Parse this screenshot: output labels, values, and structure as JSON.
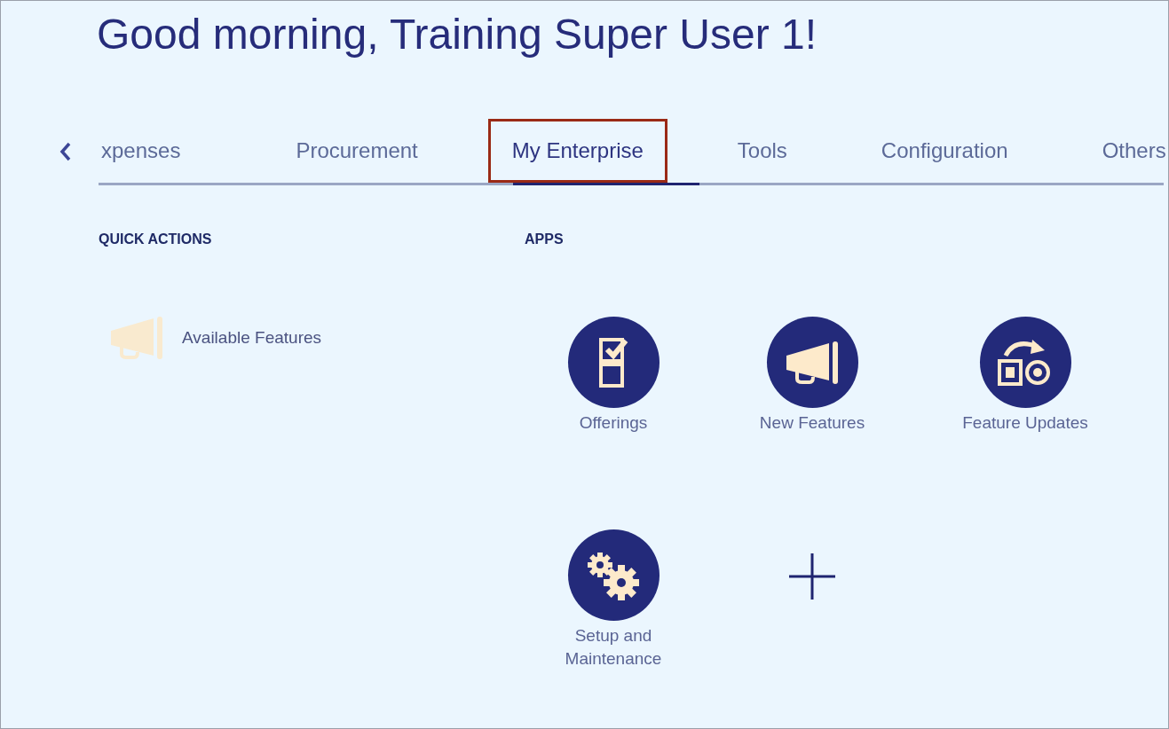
{
  "greeting": "Good morning, Training Super User 1!",
  "tabs": [
    {
      "label": "xpenses",
      "selected": false,
      "highlighted": false
    },
    {
      "label": "Procurement",
      "selected": false,
      "highlighted": false
    },
    {
      "label": "My Enterprise",
      "selected": true,
      "highlighted": true
    },
    {
      "label": "Tools",
      "selected": false,
      "highlighted": false
    },
    {
      "label": "Configuration",
      "selected": false,
      "highlighted": false
    },
    {
      "label": "Others",
      "selected": false,
      "highlighted": false
    }
  ],
  "quick_actions": {
    "heading": "QUICK ACTIONS",
    "items": [
      {
        "label": "Available Features",
        "kind": "megaphone"
      }
    ]
  },
  "apps": {
    "heading": "APPS",
    "items": [
      {
        "label": "Offerings",
        "kind": "checklist"
      },
      {
        "label": "New Features",
        "kind": "megaphone"
      },
      {
        "label": "Feature Updates",
        "kind": "update"
      },
      {
        "label": "Setup and Maintenance",
        "kind": "gears"
      }
    ]
  }
}
